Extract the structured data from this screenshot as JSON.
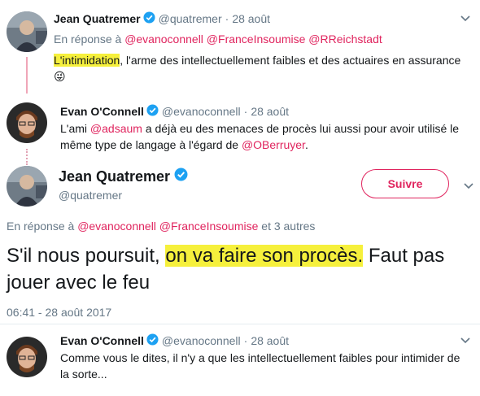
{
  "tweet1": {
    "name": "Jean Quatremer",
    "handle": "@quatremer",
    "date": "28 août",
    "reply_prefix": "En réponse à",
    "reply_mentions": "@evanoconnell @FranceInsoumise @RReichstadt",
    "text_highlight": "L'intimidation",
    "text_rest": ", l'arme des intellectuellement faibles et des actuaires en assurance",
    "emoji": "😜"
  },
  "tweet2": {
    "name": "Evan O'Connell",
    "handle": "@evanoconnell",
    "date": "28 août",
    "text_1": "L'ami ",
    "mention_1": "@adsaum",
    "text_2": " a déjà eu des menaces de procès lui aussi pour avoir utilisé le même type de langage à l'égard de ",
    "mention_2": "@OBerruyer",
    "text_3": "."
  },
  "main_tweet": {
    "name": "Jean Quatremer",
    "handle": "@quatremer",
    "follow_label": "Suivre",
    "reply_prefix": "En réponse à",
    "reply_mentions": "@evanoconnell @FranceInsoumise",
    "reply_suffix": " et 3 autres",
    "text_1": "S'il nous poursuit, ",
    "text_highlight": "on va faire son procès.",
    "text_2": " Faut pas jouer avec le feu",
    "timestamp": "06:41 - 28 août 2017"
  },
  "tweet3": {
    "name": "Evan O'Connell",
    "handle": "@evanoconnell",
    "date": "28 août",
    "text": "Comme vous le dites, il n'y a que les intellectuellement faibles pour intimider de la sorte..."
  },
  "colors": {
    "link": "#e0245e",
    "highlight": "#f6f03c",
    "verified": "#1da1f2",
    "muted": "#657786"
  },
  "icons": {
    "verified": "verified-badge-icon",
    "chevron": "chevron-down-icon"
  }
}
